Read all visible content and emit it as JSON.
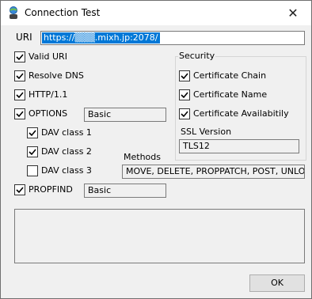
{
  "window": {
    "title": "Connection Test",
    "close_glyph": "✕",
    "app_icon": "globe-user-icon",
    "close_icon": "close-icon"
  },
  "uri": {
    "label": "URI",
    "value": "https://▒▒▒.mixh.jp:2078/"
  },
  "checks": {
    "valid_uri": "Valid URI",
    "resolve_dns": "Resolve DNS",
    "http11": "HTTP/1.1",
    "options": "OPTIONS",
    "options_value": "Basic",
    "dav1": "DAV class 1",
    "dav2": "DAV class 2",
    "dav3": "DAV class 3",
    "propfind": "PROPFIND",
    "propfind_value": "Basic",
    "methods_label": "Methods",
    "methods_value": "MOVE, DELETE, PROPPATCH, POST, UNLO("
  },
  "security": {
    "group_label": "Security",
    "chain": "Certificate Chain",
    "name": "Certificate Name",
    "availability": "Certificate Availabitily",
    "ssl_label": "SSL Version",
    "ssl_value": "TLS12"
  },
  "footer": {
    "ok_label": "OK"
  },
  "colors": {
    "selection": "#0078d7",
    "window_bg": "#f0f0f0"
  }
}
